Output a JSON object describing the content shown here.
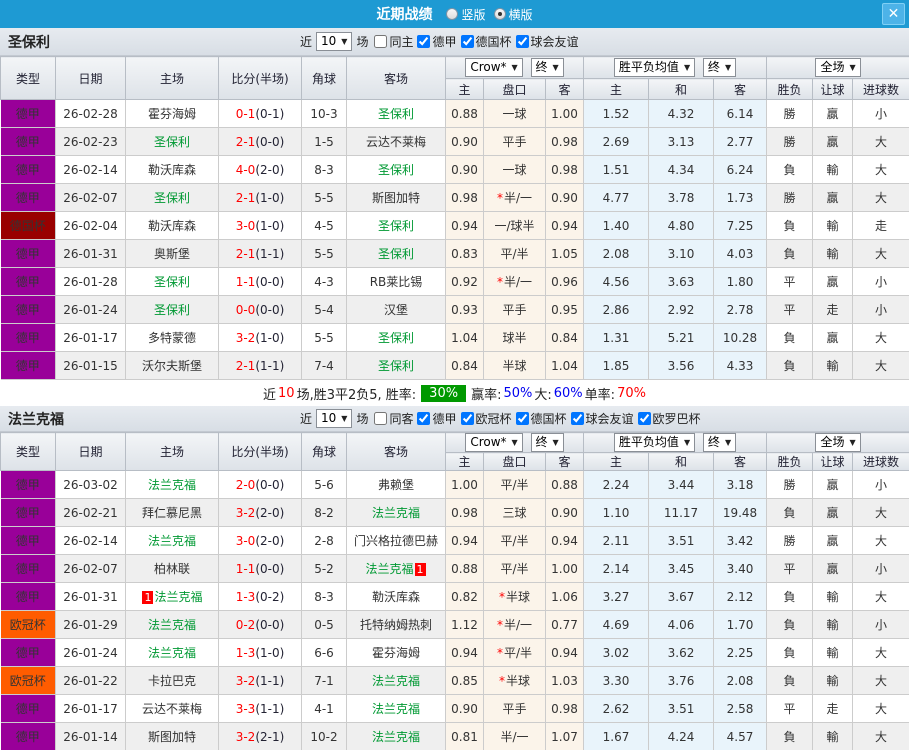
{
  "titlebar": {
    "title": "近期战绩",
    "radio_vertical": "竖版",
    "radio_horizontal": "横版",
    "close_glyph": "✕"
  },
  "filter_words": {
    "near": "近",
    "games": "场"
  },
  "dropdowns": {
    "odds_source": "Crow*",
    "final": "终",
    "avg": "胜平负均值",
    "final2": "终",
    "scope": "全场"
  },
  "columns": {
    "type": "类型",
    "date": "日期",
    "home": "主场",
    "score": "比分(半场)",
    "corner": "角球",
    "away": "客场",
    "odds_home": "主",
    "handicap": "盘口",
    "odds_away": "客",
    "avg_win": "主",
    "avg_draw": "和",
    "avg_lose": "客",
    "result_wl": "胜负",
    "result_handicap": "让球",
    "result_goals": "进球数"
  },
  "league_colors": {
    "德甲": "#990099",
    "德国杯": "#990000",
    "欧冠杯": "#ff5c00"
  },
  "sections": [
    {
      "team": "圣保利",
      "filter": {
        "n": "10",
        "same": "同主",
        "leagues": [
          "德甲",
          "德国杯",
          "球会友谊"
        ]
      },
      "rows": [
        {
          "league": "德甲",
          "date": "26-02-28",
          "home": "霍芬海姆",
          "hg": false,
          "hb": "",
          "score": "0-1",
          "half": "(0-1)",
          "corner": "10-3",
          "away": "圣保利",
          "ag": true,
          "ab": "",
          "o1": "0.88",
          "star": "",
          "hcap": "一球",
          "o2": "1.00",
          "aw": "1.52",
          "ad": "4.32",
          "al": "6.14",
          "r1": "勝",
          "c1": "r",
          "r2": "贏",
          "c2": "r",
          "r3": "小",
          "c3": "g"
        },
        {
          "league": "德甲",
          "date": "26-02-23",
          "home": "圣保利",
          "hg": true,
          "hb": "",
          "score": "2-1",
          "half": "(0-0)",
          "corner": "1-5",
          "away": "云达不莱梅",
          "ag": false,
          "ab": "",
          "o1": "0.90",
          "star": "",
          "hcap": "平手",
          "o2": "0.98",
          "aw": "2.69",
          "ad": "3.13",
          "al": "2.77",
          "r1": "勝",
          "c1": "r",
          "r2": "贏",
          "c2": "r",
          "r3": "大",
          "c3": "r"
        },
        {
          "league": "德甲",
          "date": "26-02-14",
          "home": "勒沃库森",
          "hg": false,
          "hb": "",
          "score": "4-0",
          "half": "(2-0)",
          "corner": "8-3",
          "away": "圣保利",
          "ag": true,
          "ab": "",
          "o1": "0.90",
          "star": "",
          "hcap": "一球",
          "o2": "0.98",
          "aw": "1.51",
          "ad": "4.34",
          "al": "6.24",
          "r1": "負",
          "c1": "g",
          "r2": "輸",
          "c2": "g",
          "r3": "大",
          "c3": "r"
        },
        {
          "league": "德甲",
          "date": "26-02-07",
          "home": "圣保利",
          "hg": true,
          "hb": "",
          "score": "2-1",
          "half": "(1-0)",
          "corner": "5-5",
          "away": "斯图加特",
          "ag": false,
          "ab": "",
          "o1": "0.98",
          "star": "*",
          "hcap": "半/一",
          "o2": "0.90",
          "aw": "4.77",
          "ad": "3.78",
          "al": "1.73",
          "r1": "勝",
          "c1": "r",
          "r2": "贏",
          "c2": "r",
          "r3": "大",
          "c3": "r"
        },
        {
          "league": "德国杯",
          "date": "26-02-04",
          "home": "勒沃库森",
          "hg": false,
          "hb": "",
          "score": "3-0",
          "half": "(1-0)",
          "corner": "4-5",
          "away": "圣保利",
          "ag": true,
          "ab": "",
          "o1": "0.94",
          "star": "",
          "hcap": "一/球半",
          "o2": "0.94",
          "aw": "1.40",
          "ad": "4.80",
          "al": "7.25",
          "r1": "負",
          "c1": "g",
          "r2": "輸",
          "c2": "g",
          "r3": "走",
          "c3": "b"
        },
        {
          "league": "德甲",
          "date": "26-01-31",
          "home": "奥斯堡",
          "hg": false,
          "hb": "",
          "score": "2-1",
          "half": "(1-1)",
          "corner": "5-5",
          "away": "圣保利",
          "ag": true,
          "ab": "",
          "o1": "0.83",
          "star": "",
          "hcap": "平/半",
          "o2": "1.05",
          "aw": "2.08",
          "ad": "3.10",
          "al": "4.03",
          "r1": "負",
          "c1": "g",
          "r2": "輸",
          "c2": "g",
          "r3": "大",
          "c3": "r"
        },
        {
          "league": "德甲",
          "date": "26-01-28",
          "home": "圣保利",
          "hg": true,
          "hb": "",
          "score": "1-1",
          "half": "(0-0)",
          "corner": "4-3",
          "away": "RB莱比锡",
          "ag": false,
          "ab": "",
          "o1": "0.92",
          "star": "*",
          "hcap": "半/一",
          "o2": "0.96",
          "aw": "4.56",
          "ad": "3.63",
          "al": "1.80",
          "r1": "平",
          "c1": "b",
          "r2": "贏",
          "c2": "r",
          "r3": "小",
          "c3": "g"
        },
        {
          "league": "德甲",
          "date": "26-01-24",
          "home": "圣保利",
          "hg": true,
          "hb": "",
          "score": "0-0",
          "half": "(0-0)",
          "corner": "5-4",
          "away": "汉堡",
          "ag": false,
          "ab": "",
          "o1": "0.93",
          "star": "",
          "hcap": "平手",
          "o2": "0.95",
          "aw": "2.86",
          "ad": "2.92",
          "al": "2.78",
          "r1": "平",
          "c1": "b",
          "r2": "走",
          "c2": "b",
          "r3": "小",
          "c3": "g"
        },
        {
          "league": "德甲",
          "date": "26-01-17",
          "home": "多特蒙德",
          "hg": false,
          "hb": "",
          "score": "3-2",
          "half": "(1-0)",
          "corner": "5-5",
          "away": "圣保利",
          "ag": true,
          "ab": "",
          "o1": "1.04",
          "star": "",
          "hcap": "球半",
          "o2": "0.84",
          "aw": "1.31",
          "ad": "5.21",
          "al": "10.28",
          "r1": "負",
          "c1": "g",
          "r2": "贏",
          "c2": "r",
          "r3": "大",
          "c3": "r"
        },
        {
          "league": "德甲",
          "date": "26-01-15",
          "home": "沃尔夫斯堡",
          "hg": false,
          "hb": "",
          "score": "2-1",
          "half": "(1-1)",
          "corner": "7-4",
          "away": "圣保利",
          "ag": true,
          "ab": "",
          "o1": "0.84",
          "star": "",
          "hcap": "半球",
          "o2": "1.04",
          "aw": "1.85",
          "ad": "3.56",
          "al": "4.33",
          "r1": "負",
          "c1": "g",
          "r2": "輸",
          "c2": "g",
          "r3": "大",
          "c3": "r"
        }
      ],
      "summary": [
        {
          "t": "近",
          "c": "k"
        },
        {
          "t": "10",
          "c": "r"
        },
        {
          "t": "场,胜3平2负5, 胜率:",
          "c": "k"
        },
        {
          "t": "30%",
          "c": "pct"
        },
        {
          "t": "赢率:",
          "c": "k"
        },
        {
          "t": "50%",
          "c": "b"
        },
        {
          "t": "大:",
          "c": "k"
        },
        {
          "t": "60%",
          "c": "b"
        },
        {
          "t": "单率:",
          "c": "k"
        },
        {
          "t": "70%",
          "c": "r"
        }
      ]
    },
    {
      "team": "法兰克福",
      "filter": {
        "n": "10",
        "same": "同客",
        "leagues": [
          "德甲",
          "欧冠杯",
          "德国杯",
          "球会友谊",
          "欧罗巴杯"
        ]
      },
      "rows": [
        {
          "league": "德甲",
          "date": "26-03-02",
          "home": "法兰克福",
          "hg": true,
          "hb": "",
          "score": "2-0",
          "half": "(0-0)",
          "corner": "5-6",
          "away": "弗赖堡",
          "ag": false,
          "ab": "",
          "o1": "1.00",
          "star": "",
          "hcap": "平/半",
          "o2": "0.88",
          "aw": "2.24",
          "ad": "3.44",
          "al": "3.18",
          "r1": "勝",
          "c1": "r",
          "r2": "贏",
          "c2": "r",
          "r3": "小",
          "c3": "g"
        },
        {
          "league": "德甲",
          "date": "26-02-21",
          "home": "拜仁慕尼黑",
          "hg": false,
          "hb": "",
          "score": "3-2",
          "half": "(2-0)",
          "corner": "8-2",
          "away": "法兰克福",
          "ag": true,
          "ab": "",
          "o1": "0.98",
          "star": "",
          "hcap": "三球",
          "o2": "0.90",
          "aw": "1.10",
          "ad": "11.17",
          "al": "19.48",
          "r1": "負",
          "c1": "g",
          "r2": "贏",
          "c2": "r",
          "r3": "大",
          "c3": "r"
        },
        {
          "league": "德甲",
          "date": "26-02-14",
          "home": "法兰克福",
          "hg": true,
          "hb": "",
          "score": "3-0",
          "half": "(2-0)",
          "corner": "2-8",
          "away": "门兴格拉德巴赫",
          "ag": false,
          "ab": "",
          "o1": "0.94",
          "star": "",
          "hcap": "平/半",
          "o2": "0.94",
          "aw": "2.11",
          "ad": "3.51",
          "al": "3.42",
          "r1": "勝",
          "c1": "r",
          "r2": "贏",
          "c2": "r",
          "r3": "大",
          "c3": "r"
        },
        {
          "league": "德甲",
          "date": "26-02-07",
          "home": "柏林联",
          "hg": false,
          "hb": "",
          "score": "1-1",
          "half": "(0-0)",
          "corner": "5-2",
          "away": "法兰克福",
          "ag": true,
          "ab": "1",
          "o1": "0.88",
          "star": "",
          "hcap": "平/半",
          "o2": "1.00",
          "aw": "2.14",
          "ad": "3.45",
          "al": "3.40",
          "r1": "平",
          "c1": "b",
          "r2": "贏",
          "c2": "r",
          "r3": "小",
          "c3": "g"
        },
        {
          "league": "德甲",
          "date": "26-01-31",
          "home": "法兰克福",
          "hg": true,
          "hb": "1",
          "score": "1-3",
          "half": "(0-2)",
          "corner": "8-3",
          "away": "勒沃库森",
          "ag": false,
          "ab": "",
          "o1": "0.82",
          "star": "*",
          "hcap": "半球",
          "o2": "1.06",
          "aw": "3.27",
          "ad": "3.67",
          "al": "2.12",
          "r1": "負",
          "c1": "g",
          "r2": "輸",
          "c2": "g",
          "r3": "大",
          "c3": "r"
        },
        {
          "league": "欧冠杯",
          "date": "26-01-29",
          "home": "法兰克福",
          "hg": true,
          "hb": "",
          "score": "0-2",
          "half": "(0-0)",
          "corner": "0-5",
          "away": "托特纳姆热刺",
          "ag": false,
          "ab": "",
          "o1": "1.12",
          "star": "*",
          "hcap": "半/一",
          "o2": "0.77",
          "aw": "4.69",
          "ad": "4.06",
          "al": "1.70",
          "r1": "負",
          "c1": "g",
          "r2": "輸",
          "c2": "g",
          "r3": "小",
          "c3": "g"
        },
        {
          "league": "德甲",
          "date": "26-01-24",
          "home": "法兰克福",
          "hg": true,
          "hb": "",
          "score": "1-3",
          "half": "(1-0)",
          "corner": "6-6",
          "away": "霍芬海姆",
          "ag": false,
          "ab": "",
          "o1": "0.94",
          "star": "*",
          "hcap": "平/半",
          "o2": "0.94",
          "aw": "3.02",
          "ad": "3.62",
          "al": "2.25",
          "r1": "負",
          "c1": "g",
          "r2": "輸",
          "c2": "g",
          "r3": "大",
          "c3": "r"
        },
        {
          "league": "欧冠杯",
          "date": "26-01-22",
          "home": "卡拉巴克",
          "hg": false,
          "hb": "",
          "score": "3-2",
          "half": "(1-1)",
          "corner": "7-1",
          "away": "法兰克福",
          "ag": true,
          "ab": "",
          "o1": "0.85",
          "star": "*",
          "hcap": "半球",
          "o2": "1.03",
          "aw": "3.30",
          "ad": "3.76",
          "al": "2.08",
          "r1": "負",
          "c1": "g",
          "r2": "輸",
          "c2": "g",
          "r3": "大",
          "c3": "r"
        },
        {
          "league": "德甲",
          "date": "26-01-17",
          "home": "云达不莱梅",
          "hg": false,
          "hb": "",
          "score": "3-3",
          "half": "(1-1)",
          "corner": "4-1",
          "away": "法兰克福",
          "ag": true,
          "ab": "",
          "o1": "0.90",
          "star": "",
          "hcap": "平手",
          "o2": "0.98",
          "aw": "2.62",
          "ad": "3.51",
          "al": "2.58",
          "r1": "平",
          "c1": "b",
          "r2": "走",
          "c2": "b",
          "r3": "大",
          "c3": "r"
        },
        {
          "league": "德甲",
          "date": "26-01-14",
          "home": "斯图加特",
          "hg": false,
          "hb": "",
          "score": "3-2",
          "half": "(2-1)",
          "corner": "10-2",
          "away": "法兰克福",
          "ag": true,
          "ab": "",
          "o1": "0.81",
          "star": "",
          "hcap": "半/一",
          "o2": "1.07",
          "aw": "1.67",
          "ad": "4.24",
          "al": "4.57",
          "r1": "負",
          "c1": "g",
          "r2": "輸",
          "c2": "g",
          "r3": "大",
          "c3": "r"
        }
      ]
    }
  ]
}
